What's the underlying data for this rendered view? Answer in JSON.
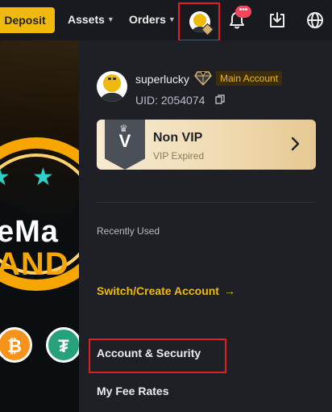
{
  "topbar": {
    "deposit_label": "Deposit",
    "assets_label": "Assets",
    "orders_label": "Orders",
    "notification_badge": "•••",
    "icons": [
      "avatar",
      "bell-icon",
      "download-icon",
      "globe-icon"
    ]
  },
  "banner": {
    "line1": "eMa",
    "line2": "AND",
    "coins": [
      "btc-coin",
      "usdt-coin"
    ]
  },
  "profile": {
    "username": "superlucky",
    "account_type": "Main Account",
    "uid": "UID: 2054074"
  },
  "vip": {
    "title": "Non VIP",
    "subtitle": "VIP Expired",
    "badge": "V"
  },
  "recently_used_label": "Recently Used",
  "switch_account_label": "Switch/Create Account",
  "menu": [
    {
      "label": "Account & Security"
    },
    {
      "label": "My Fee Rates"
    }
  ],
  "colors": {
    "accent": "#f0b90b",
    "background": "#181a20",
    "panel": "#1e2026",
    "highlight": "#e02020",
    "badge": "#f6465d"
  }
}
